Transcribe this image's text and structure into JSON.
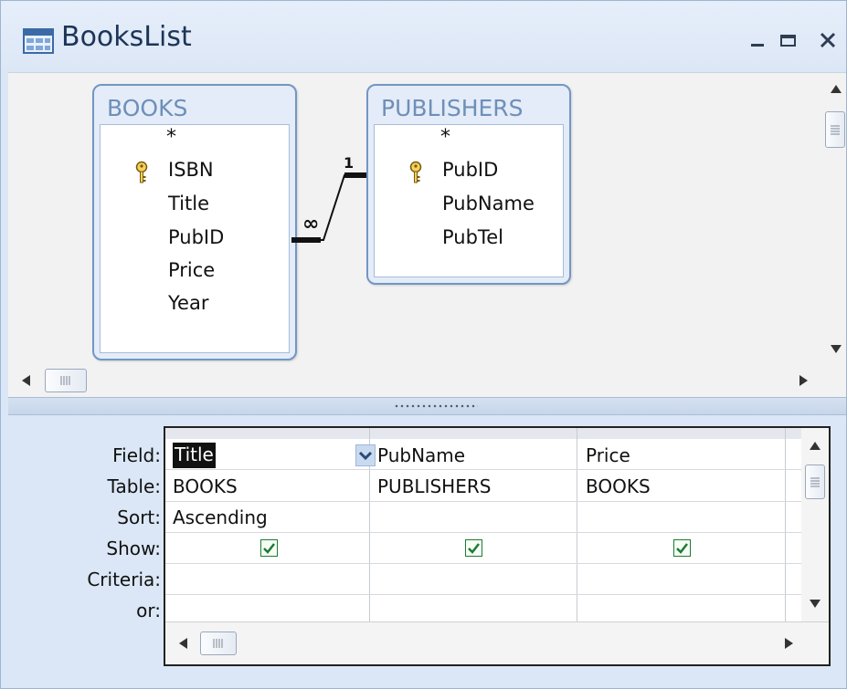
{
  "window": {
    "title": "BooksList",
    "controls": {
      "minimize": "_",
      "maximize": "□",
      "close": "X"
    }
  },
  "tables": {
    "books": {
      "name": "BOOKS",
      "fields": [
        "*",
        "ISBN",
        "Title",
        "PubID",
        "Price",
        "Year"
      ],
      "primary_key": "ISBN"
    },
    "publishers": {
      "name": "PUBLISHERS",
      "fields": [
        "*",
        "PubID",
        "PubName",
        "PubTel"
      ],
      "primary_key": "PubID"
    }
  },
  "relationship": {
    "many_label": "∞",
    "one_label": "1"
  },
  "grid": {
    "row_labels": [
      "Field:",
      "Table:",
      "Sort:",
      "Show:",
      "Criteria:",
      "or:"
    ],
    "columns": [
      {
        "field": "Title",
        "table": "BOOKS",
        "sort": "Ascending",
        "show": true,
        "criteria": "",
        "or": ""
      },
      {
        "field": "PubName",
        "table": "PUBLISHERS",
        "sort": "",
        "show": true,
        "criteria": "",
        "or": ""
      },
      {
        "field": "Price",
        "table": "BOOKS",
        "sort": "",
        "show": true,
        "criteria": "",
        "or": ""
      }
    ]
  },
  "colors": {
    "frame": "#dbe7f6",
    "table_border": "#7396c4",
    "checkbox_green": "#1e7a33"
  }
}
